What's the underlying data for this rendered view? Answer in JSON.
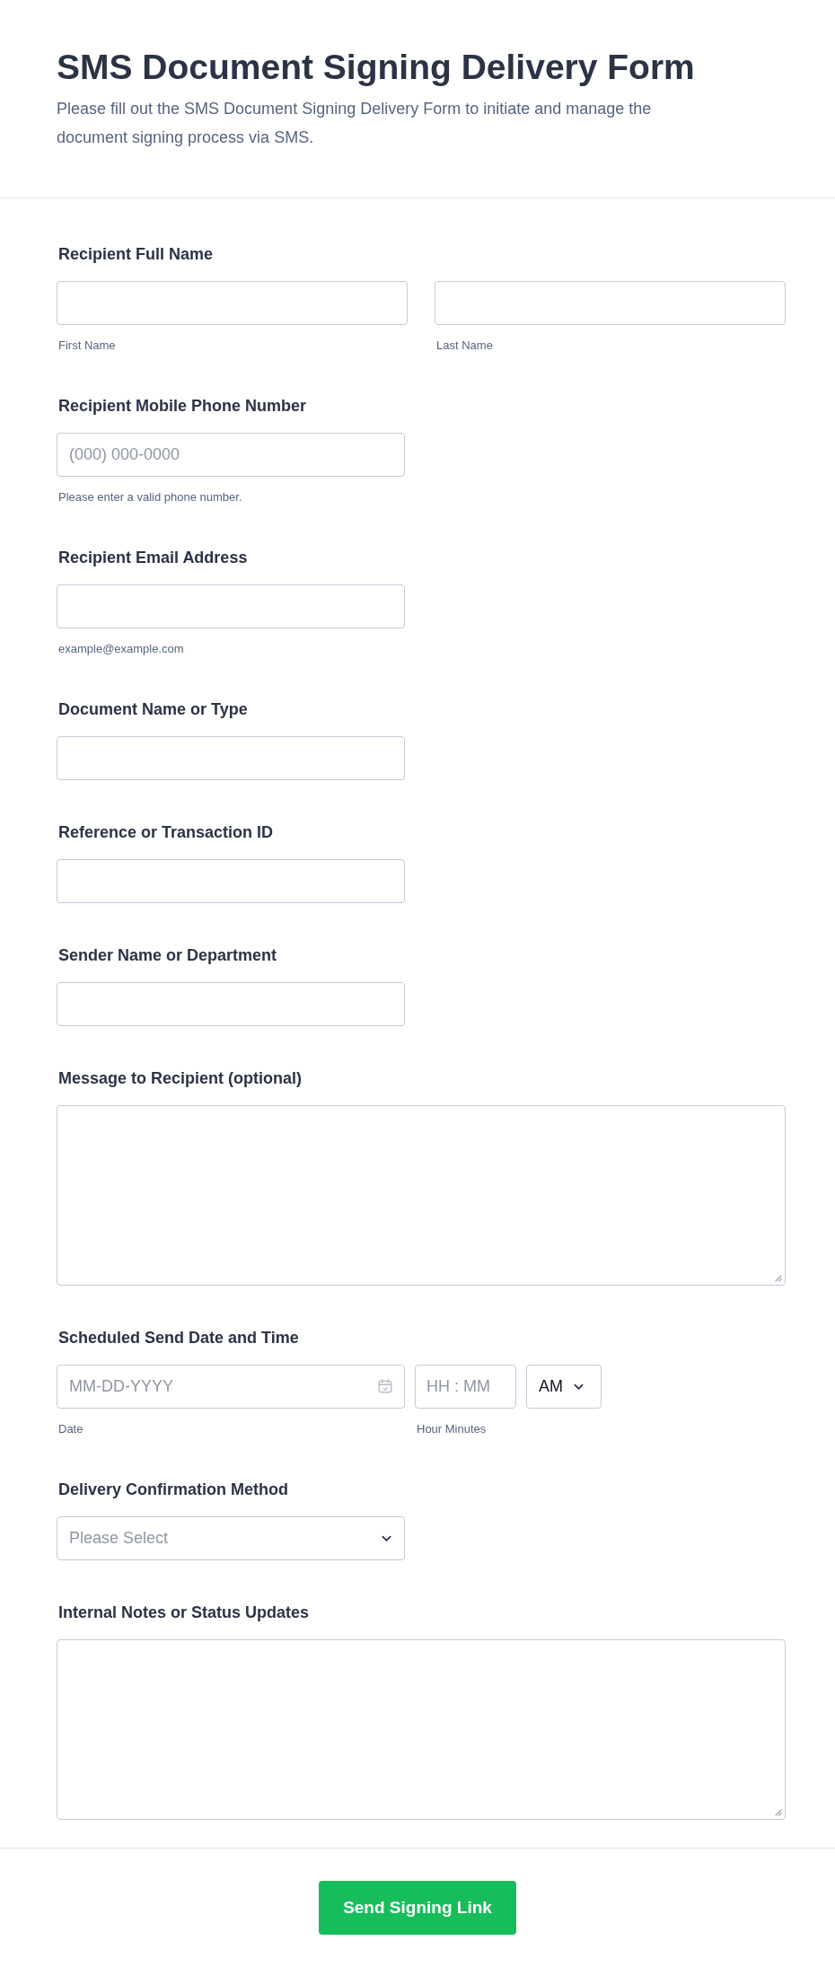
{
  "header": {
    "title": "SMS Document Signing Delivery Form",
    "description": "Please fill out the SMS Document Signing Delivery Form to initiate and manage the document signing process via SMS."
  },
  "fields": [
    {
      "kind": "name_pair",
      "label": "Recipient Full Name",
      "parts": [
        {
          "sublabel": "First Name"
        },
        {
          "sublabel": "Last Name"
        }
      ]
    },
    {
      "kind": "text",
      "label": "Recipient Mobile Phone Number",
      "placeholder": "(000) 000-0000",
      "sublabel": "Please enter a valid phone number."
    },
    {
      "kind": "text",
      "label": "Recipient Email Address",
      "sublabel": "example@example.com"
    },
    {
      "kind": "text",
      "label": "Document Name or Type"
    },
    {
      "kind": "text",
      "label": "Reference or Transaction ID"
    },
    {
      "kind": "text",
      "label": "Sender Name or Department"
    },
    {
      "kind": "textarea",
      "label": "Message to Recipient (optional)"
    },
    {
      "kind": "datetime",
      "label": "Scheduled Send Date and Time",
      "date_placeholder": "MM-DD-YYYY",
      "date_sublabel": "Date",
      "time_placeholder": "HH : MM",
      "time_sublabel": "Hour Minutes",
      "ampm": "AM"
    },
    {
      "kind": "select",
      "label": "Delivery Confirmation Method",
      "placeholder": "Please Select"
    },
    {
      "kind": "textarea",
      "label": "Internal Notes or Status Updates"
    }
  ],
  "submit": {
    "label": "Send Signing Link"
  }
}
